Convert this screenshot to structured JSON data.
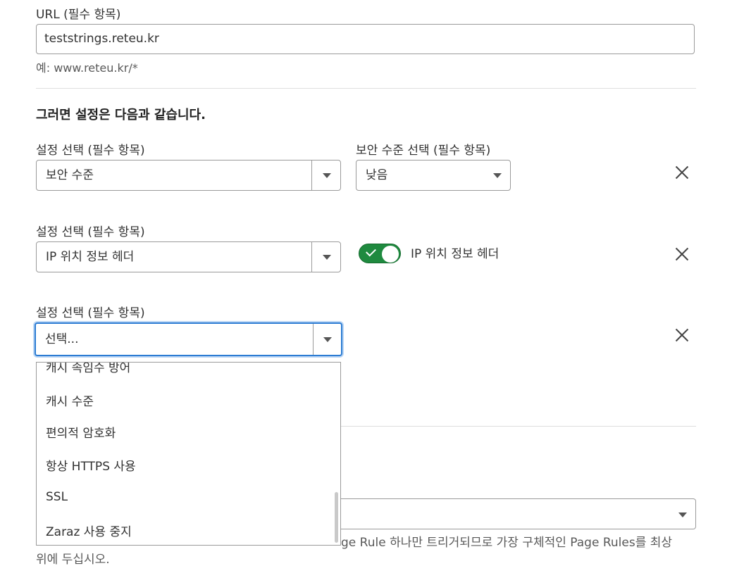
{
  "url_section": {
    "label": "URL (필수 항목)",
    "value": "teststrings.reteu.kr",
    "example": "예: www.reteu.kr/*"
  },
  "settings_heading": "그러면 설정은 다음과 같습니다.",
  "rows": [
    {
      "setting_label": "설정 선택 (필수 항목)",
      "setting_value": "보안 수준",
      "secondary_label": "보안 수준 선택 (필수 항목)",
      "secondary_value": "낮음"
    },
    {
      "setting_label": "설정 선택 (필수 항목)",
      "setting_value": "IP 위치 정보 헤더",
      "toggle_label": "IP 위치 정보 헤더",
      "toggle_on": true
    },
    {
      "setting_label": "설정 선택 (필수 항목)",
      "setting_placeholder": "선택..."
    }
  ],
  "dropdown_options": [
    "캐시 속임수 방어",
    "캐시 수준",
    "편의적 암호화",
    "항상 HTTPS 사용",
    "SSL",
    "Zaraz 사용 중지"
  ],
  "footnote": {
    "line1": "ge Rule 하나만 트리거되므로 가장 구체적인 Page Rules를 최상",
    "line2": "위에 두십시오."
  },
  "colors": {
    "focus_border": "#2c7cd3",
    "toggle_on": "#1f8a3f"
  },
  "icons": {
    "close": "close-icon",
    "dropdown_arrow": "chevron-down-icon",
    "toggle_check": "check-icon"
  }
}
